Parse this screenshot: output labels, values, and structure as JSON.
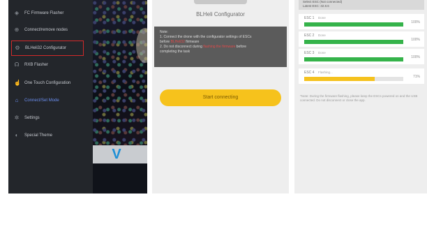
{
  "drawer": {
    "items": [
      {
        "icon": "flight-controller-icon",
        "glyph": "◈",
        "label": "FC Firmware Flasher"
      },
      {
        "icon": "connect-icon",
        "glyph": "⊕",
        "label": "Connect/remove nodes"
      },
      {
        "icon": "blheli-icon",
        "glyph": "⚙",
        "label": "BLHeli32 Configurator"
      },
      {
        "icon": "radio-icon",
        "glyph": "☊",
        "label": "RXB Flasher"
      },
      {
        "icon": "touch-icon",
        "glyph": "☝",
        "label": "One Touch Configuration"
      },
      {
        "icon": "home-icon",
        "glyph": "⌂",
        "label": "Connect/Set Mode"
      },
      {
        "icon": "gear-icon",
        "glyph": "✲",
        "label": "Settings"
      },
      {
        "icon": "theme-icon",
        "glyph": "◐",
        "label": "Special Theme"
      }
    ],
    "selected_index": 2,
    "active_index": 5,
    "logo_glyph": "V"
  },
  "configurator": {
    "title": "BLHeli Configurator",
    "notice": {
      "heading": "Note:",
      "line1_a": "1. Connect the drone with the configurator settings of ESCs",
      "line1_b": "before ",
      "line1_red": "BLHeli32",
      "line1_c": " firmware",
      "line2_a": "2. Do not disconnect during ",
      "line2_red": "flashing the firmware",
      "line2_b": " before",
      "line3": "completing the task"
    },
    "start_button": "Start connecting"
  },
  "esc_panel": {
    "header_line1": "Select ESC (Not connected)",
    "header_line2": "Latest ESC: 32.8.6",
    "rows": [
      {
        "name": "ESC 1",
        "status": "Done",
        "progress": 1.0,
        "percent": "100%",
        "color": "#35b34a"
      },
      {
        "name": "ESC 2",
        "status": "Done",
        "progress": 1.0,
        "percent": "100%",
        "color": "#35b34a"
      },
      {
        "name": "ESC 3",
        "status": "Done",
        "progress": 1.0,
        "percent": "100%",
        "color": "#35b34a"
      },
      {
        "name": "ESC 4",
        "status": "Flashing...",
        "progress": 0.71,
        "percent": "71%",
        "color": "#f5c21e"
      }
    ],
    "note": "*Note: During the firmware flashing, please keep the ESCs powered on and the USB connected. Do not disconnect or close the app."
  }
}
